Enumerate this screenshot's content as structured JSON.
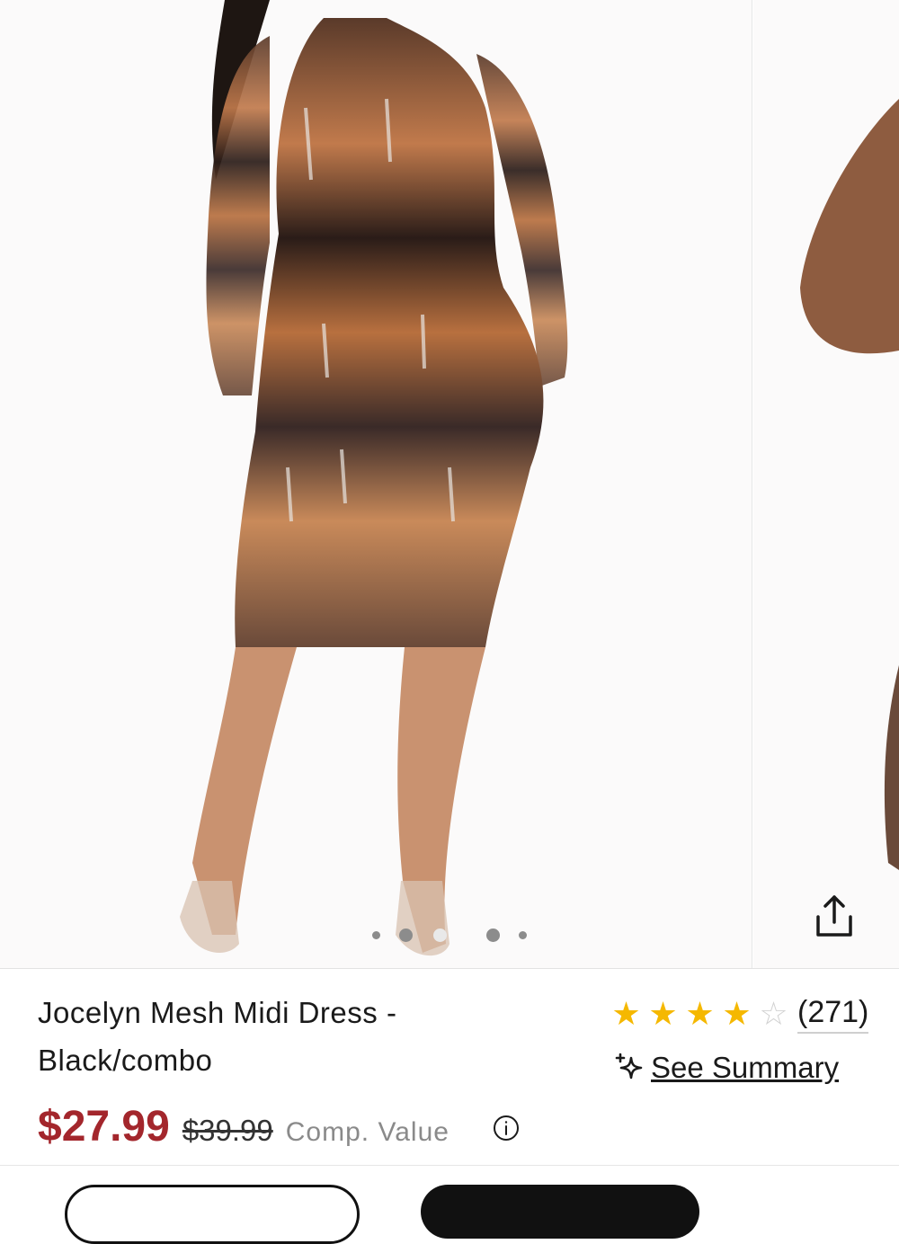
{
  "product": {
    "title_line1": "Jocelyn Mesh Midi Dress -",
    "title_line2": "Black/combo",
    "price_current": "$27.99",
    "price_original": "$39.99",
    "comp_value_label": "Comp. Value",
    "rating_value": 4,
    "rating_max": 5,
    "review_count": "(271)",
    "see_summary_label": "See Summary"
  },
  "gallery": {
    "dot_count": 5,
    "active_dot": 1
  },
  "icons": {
    "share": "share-icon",
    "sparkle": "sparkle-icon",
    "info": "info-icon",
    "star": "star-icon"
  },
  "colors": {
    "price_accent": "#a3262c",
    "star_filled": "#f5b800",
    "star_empty": "#d2d2d2",
    "muted_text": "#8a8a8a"
  }
}
